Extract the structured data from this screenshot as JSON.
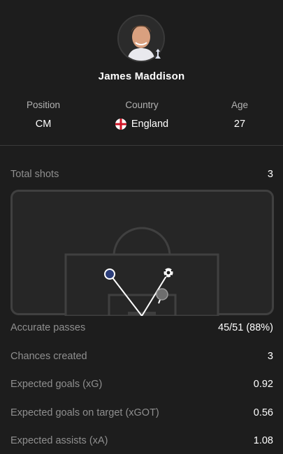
{
  "player": {
    "name": "James Maddison",
    "avatar_icon": "player-portrait",
    "club_badge_icon": "club-crest-icon"
  },
  "info": {
    "position_label": "Position",
    "position_value": "CM",
    "country_label": "Country",
    "country_value": "England",
    "country_flag_icon": "england-flag-icon",
    "age_label": "Age",
    "age_value": "27"
  },
  "stats": {
    "total_shots_label": "Total shots",
    "total_shots_value": "3",
    "accurate_passes_label": "Accurate passes",
    "accurate_passes_value": "45/51 (88%)",
    "chances_created_label": "Chances created",
    "chances_created_value": "3",
    "xg_label": "Expected goals (xG)",
    "xg_value": "0.92",
    "xgot_label": "Expected goals on target (xGOT)",
    "xgot_value": "0.56",
    "xa_label": "Expected assists (xA)",
    "xa_value": "1.08"
  },
  "shot_map": {
    "shots": [
      {
        "type": "miss",
        "color": "#2c3e7a"
      },
      {
        "type": "goal",
        "icon": "football-icon"
      },
      {
        "type": "blocked",
        "color": "#6e6e6e"
      }
    ]
  },
  "colors": {
    "background": "#1d1d1d",
    "pitch_lines": "#3f3f3f",
    "label_muted": "#8f8f8f"
  }
}
